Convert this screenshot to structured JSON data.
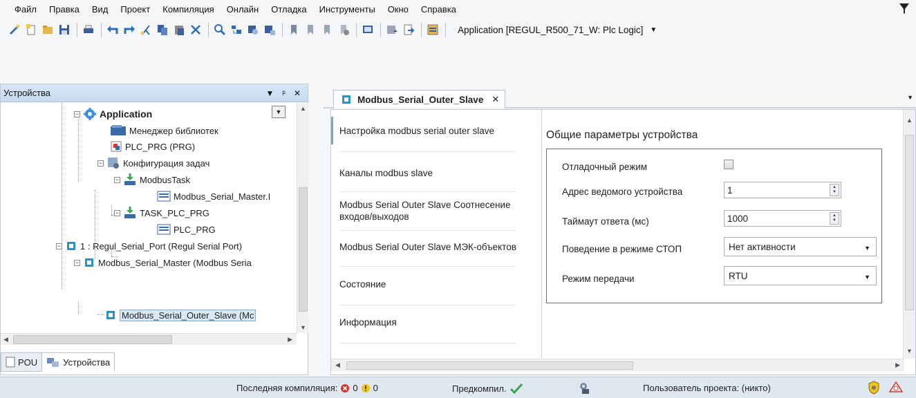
{
  "menu": [
    "Файл",
    "Правка",
    "Вид",
    "Проект",
    "Компиляция",
    "Онлайн",
    "Отладка",
    "Инструменты",
    "Окно",
    "Справка"
  ],
  "toolbar": {
    "icons": [
      "new-object-icon",
      "new-file-icon",
      "open-project-icon",
      "save-icon",
      "print-icon",
      "undo-icon",
      "redo-icon",
      "cut-icon",
      "copy-icon",
      "paste-icon",
      "delete-icon",
      "find-icon",
      "find-replace-icon",
      "browse-icon",
      "browse-next-icon",
      "bookmark-icon",
      "bookmark-next-icon",
      "bookmark-prev-icon",
      "bookmark-clear-icon",
      "screen-icon",
      "device-menu-icon",
      "device-export-icon",
      "task-config-icon"
    ],
    "application_select": "Application [REGUL_R500_71_W: Plc Logic]"
  },
  "devices_pane": {
    "title": "Устройства",
    "tree": [
      {
        "label": "Application",
        "icon": "application-gear-icon"
      },
      {
        "label": "Менеджер библиотек",
        "icon": "library-icon"
      },
      {
        "label": "PLC_PRG (PRG)",
        "icon": "program-icon"
      },
      {
        "label": "Конфигурация задач",
        "icon": "task-config-icon"
      },
      {
        "label": "ModbusTask",
        "icon": "task-icon"
      },
      {
        "label": "Modbus_Serial_Master.I",
        "icon": "task-call-icon"
      },
      {
        "label": "TASK_PLC_PRG",
        "icon": "task-icon"
      },
      {
        "label": "PLC_PRG",
        "icon": "task-call-icon"
      },
      {
        "label": "1 : Regul_Serial_Port (Regul Serial Port)",
        "icon": "device-icon"
      },
      {
        "label": "Modbus_Serial_Master (Modbus Seria",
        "icon": "device-icon"
      },
      {
        "label": "Modbus_Serial_Outer_Slave (Mc",
        "icon": "device-icon"
      }
    ],
    "bottom_tabs": [
      "POU",
      "Устройства"
    ]
  },
  "editor": {
    "tab_title": "Modbus_Serial_Outer_Slave",
    "vtabs": [
      "Настройка modbus serial outer slave",
      "Каналы modbus slave",
      "Modbus Serial Outer Slave Соотнесение входов/выходов",
      "Modbus Serial Outer Slave МЭК-объектов",
      "Состояние",
      "Информация"
    ],
    "section_title": "Общие параметры устройства",
    "fields": {
      "debug_label": "Отладочный режим",
      "address_label": "Адрес ведомого устройства",
      "address_value": "1",
      "timeout_label": "Таймаут ответа (мс)",
      "timeout_value": "1000",
      "stop_label": "Поведение в режиме СТОП",
      "stop_value": "Нет активности",
      "mode_label": "Режим передачи",
      "mode_value": "RTU"
    }
  },
  "statusbar": {
    "last_compile": "Последняя компиляция:",
    "errors": "0",
    "warnings": "0",
    "precompile": "Предкомпил.",
    "user": "Пользователь проекта: (никто)"
  },
  "colors": {
    "accent": "#7aa7d8",
    "pane_header": "#c7dbf1",
    "statusbar": "#dfe7f0"
  }
}
